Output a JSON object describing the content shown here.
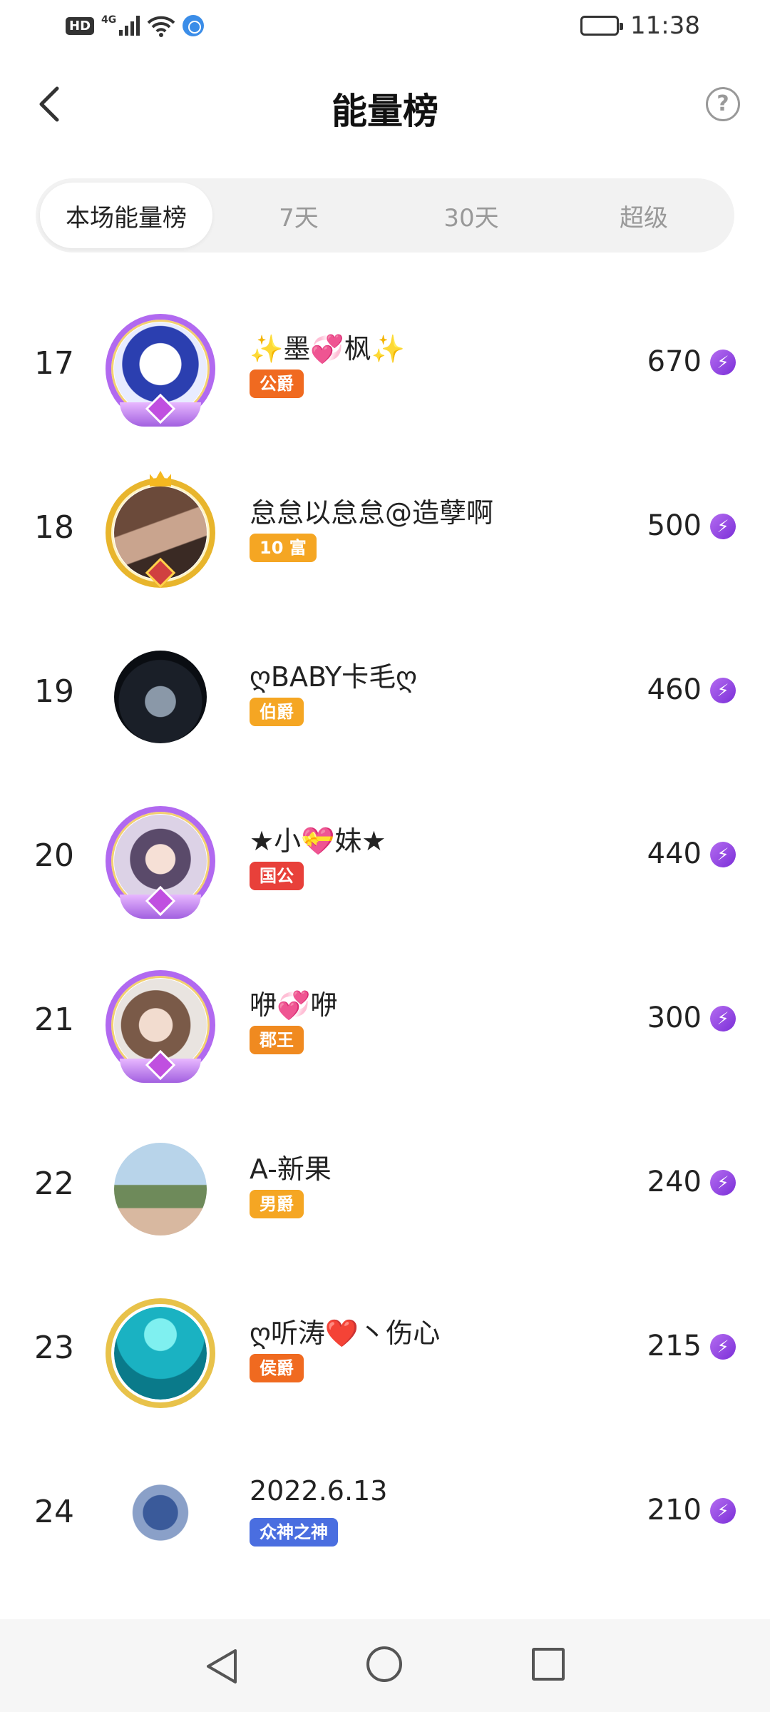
{
  "status_bar": {
    "hd": "HD",
    "net": "4G",
    "time": "11:38"
  },
  "header": {
    "title": "能量榜",
    "help": "?"
  },
  "tabs": [
    {
      "label": "本场能量榜",
      "active": true
    },
    {
      "label": "7天",
      "active": false
    },
    {
      "label": "30天",
      "active": false
    },
    {
      "label": "超级",
      "active": false
    }
  ],
  "rows": [
    {
      "rank": "17",
      "name": "✨墨💞枫✨",
      "badge": "公爵",
      "score": "670",
      "frame": "purple",
      "badge_color": "#f06a20"
    },
    {
      "rank": "18",
      "name": "怠怠以怠怠@造孽啊",
      "badge": "10 富",
      "score": "500",
      "frame": "gold",
      "badge_color": "#f5a623"
    },
    {
      "rank": "19",
      "name": "ღBABY卡毛ღ",
      "badge": "伯爵",
      "score": "460",
      "frame": "none",
      "badge_color": "#f5a623"
    },
    {
      "rank": "20",
      "name": "★小💝妹★",
      "badge": "国公",
      "score": "440",
      "frame": "purple",
      "badge_color": "#e8403a"
    },
    {
      "rank": "21",
      "name": "咿💞咿",
      "badge": "郡王",
      "score": "300",
      "frame": "purple",
      "badge_color": "#f08a20"
    },
    {
      "rank": "22",
      "name": "A-新果",
      "badge": "男爵",
      "score": "240",
      "frame": "none",
      "badge_color": "#f5a623"
    },
    {
      "rank": "23",
      "name": "ღ听涛❤️丶伤心",
      "badge": "侯爵",
      "score": "215",
      "frame": "teal",
      "badge_color": "#f06a20"
    },
    {
      "rank": "24",
      "name": "2022.6.13",
      "badge": "众神之神",
      "score": "210",
      "frame": "none",
      "badge_color": "#4a6ee0"
    }
  ],
  "energy_icon": "lightning-icon",
  "energy_glyph": "⚡"
}
